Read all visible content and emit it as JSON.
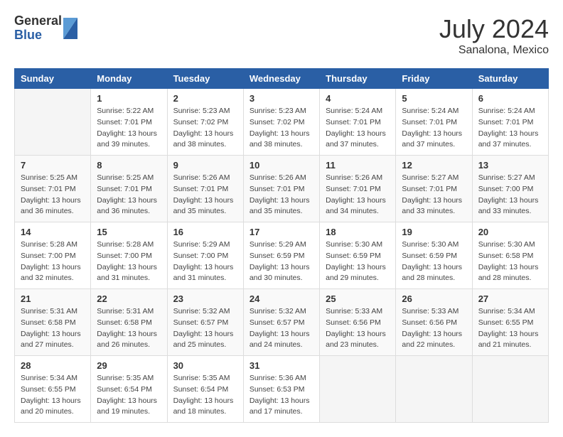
{
  "header": {
    "logo_general": "General",
    "logo_blue": "Blue",
    "month_title": "July 2024",
    "location": "Sanalona, Mexico"
  },
  "calendar": {
    "days_of_week": [
      "Sunday",
      "Monday",
      "Tuesday",
      "Wednesday",
      "Thursday",
      "Friday",
      "Saturday"
    ],
    "weeks": [
      [
        {
          "day": "",
          "info": ""
        },
        {
          "day": "1",
          "info": "Sunrise: 5:22 AM\nSunset: 7:01 PM\nDaylight: 13 hours\nand 39 minutes."
        },
        {
          "day": "2",
          "info": "Sunrise: 5:23 AM\nSunset: 7:02 PM\nDaylight: 13 hours\nand 38 minutes."
        },
        {
          "day": "3",
          "info": "Sunrise: 5:23 AM\nSunset: 7:02 PM\nDaylight: 13 hours\nand 38 minutes."
        },
        {
          "day": "4",
          "info": "Sunrise: 5:24 AM\nSunset: 7:01 PM\nDaylight: 13 hours\nand 37 minutes."
        },
        {
          "day": "5",
          "info": "Sunrise: 5:24 AM\nSunset: 7:01 PM\nDaylight: 13 hours\nand 37 minutes."
        },
        {
          "day": "6",
          "info": "Sunrise: 5:24 AM\nSunset: 7:01 PM\nDaylight: 13 hours\nand 37 minutes."
        }
      ],
      [
        {
          "day": "7",
          "info": "Sunrise: 5:25 AM\nSunset: 7:01 PM\nDaylight: 13 hours\nand 36 minutes."
        },
        {
          "day": "8",
          "info": "Sunrise: 5:25 AM\nSunset: 7:01 PM\nDaylight: 13 hours\nand 36 minutes."
        },
        {
          "day": "9",
          "info": "Sunrise: 5:26 AM\nSunset: 7:01 PM\nDaylight: 13 hours\nand 35 minutes."
        },
        {
          "day": "10",
          "info": "Sunrise: 5:26 AM\nSunset: 7:01 PM\nDaylight: 13 hours\nand 35 minutes."
        },
        {
          "day": "11",
          "info": "Sunrise: 5:26 AM\nSunset: 7:01 PM\nDaylight: 13 hours\nand 34 minutes."
        },
        {
          "day": "12",
          "info": "Sunrise: 5:27 AM\nSunset: 7:01 PM\nDaylight: 13 hours\nand 33 minutes."
        },
        {
          "day": "13",
          "info": "Sunrise: 5:27 AM\nSunset: 7:00 PM\nDaylight: 13 hours\nand 33 minutes."
        }
      ],
      [
        {
          "day": "14",
          "info": "Sunrise: 5:28 AM\nSunset: 7:00 PM\nDaylight: 13 hours\nand 32 minutes."
        },
        {
          "day": "15",
          "info": "Sunrise: 5:28 AM\nSunset: 7:00 PM\nDaylight: 13 hours\nand 31 minutes."
        },
        {
          "day": "16",
          "info": "Sunrise: 5:29 AM\nSunset: 7:00 PM\nDaylight: 13 hours\nand 31 minutes."
        },
        {
          "day": "17",
          "info": "Sunrise: 5:29 AM\nSunset: 6:59 PM\nDaylight: 13 hours\nand 30 minutes."
        },
        {
          "day": "18",
          "info": "Sunrise: 5:30 AM\nSunset: 6:59 PM\nDaylight: 13 hours\nand 29 minutes."
        },
        {
          "day": "19",
          "info": "Sunrise: 5:30 AM\nSunset: 6:59 PM\nDaylight: 13 hours\nand 28 minutes."
        },
        {
          "day": "20",
          "info": "Sunrise: 5:30 AM\nSunset: 6:58 PM\nDaylight: 13 hours\nand 28 minutes."
        }
      ],
      [
        {
          "day": "21",
          "info": "Sunrise: 5:31 AM\nSunset: 6:58 PM\nDaylight: 13 hours\nand 27 minutes."
        },
        {
          "day": "22",
          "info": "Sunrise: 5:31 AM\nSunset: 6:58 PM\nDaylight: 13 hours\nand 26 minutes."
        },
        {
          "day": "23",
          "info": "Sunrise: 5:32 AM\nSunset: 6:57 PM\nDaylight: 13 hours\nand 25 minutes."
        },
        {
          "day": "24",
          "info": "Sunrise: 5:32 AM\nSunset: 6:57 PM\nDaylight: 13 hours\nand 24 minutes."
        },
        {
          "day": "25",
          "info": "Sunrise: 5:33 AM\nSunset: 6:56 PM\nDaylight: 13 hours\nand 23 minutes."
        },
        {
          "day": "26",
          "info": "Sunrise: 5:33 AM\nSunset: 6:56 PM\nDaylight: 13 hours\nand 22 minutes."
        },
        {
          "day": "27",
          "info": "Sunrise: 5:34 AM\nSunset: 6:55 PM\nDaylight: 13 hours\nand 21 minutes."
        }
      ],
      [
        {
          "day": "28",
          "info": "Sunrise: 5:34 AM\nSunset: 6:55 PM\nDaylight: 13 hours\nand 20 minutes."
        },
        {
          "day": "29",
          "info": "Sunrise: 5:35 AM\nSunset: 6:54 PM\nDaylight: 13 hours\nand 19 minutes."
        },
        {
          "day": "30",
          "info": "Sunrise: 5:35 AM\nSunset: 6:54 PM\nDaylight: 13 hours\nand 18 minutes."
        },
        {
          "day": "31",
          "info": "Sunrise: 5:36 AM\nSunset: 6:53 PM\nDaylight: 13 hours\nand 17 minutes."
        },
        {
          "day": "",
          "info": ""
        },
        {
          "day": "",
          "info": ""
        },
        {
          "day": "",
          "info": ""
        }
      ]
    ]
  }
}
